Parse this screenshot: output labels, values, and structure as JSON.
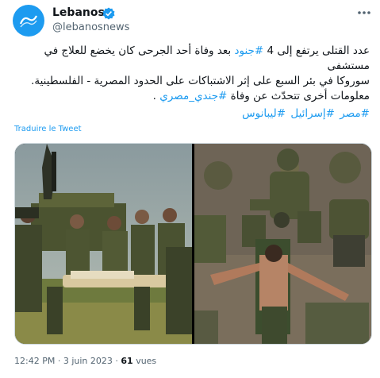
{
  "account": {
    "name": "Lebanos",
    "handle": "@lebanosnews",
    "avatar_icon": "lebanos-logo-icon",
    "verified_icon": "verified-badge-icon",
    "more_icon": "more-horizontal-icon"
  },
  "tweet": {
    "line1_text": "عدد القتلى يرتفع إلى 4 ",
    "line1_tag": "#جنود",
    "line1_rest": " بعد وفاة أحد الجرحى كان يخضع للعلاج في مستشفى",
    "line2": "سوروكا في بئر السبع على إثر الاشتباكات على الحدود المصرية - الفلسطينية.",
    "line3_text": "معلومات أخرى تتحدّث عن وفاة ",
    "line3_tag": "#جندي_مصري",
    "line3_end": " .",
    "hashtags": [
      "#مصر",
      "#إسرائيل",
      "#ليبانوس"
    ]
  },
  "translate_label": "Traduire le Tweet",
  "meta": {
    "time": "12:42 PM",
    "date": "3 juin 2023",
    "views_count": "61",
    "views_label": "vues",
    "separator": "·"
  },
  "colors": {
    "accent": "#1d9bf0",
    "text": "#0f1419",
    "muted": "#536471"
  }
}
